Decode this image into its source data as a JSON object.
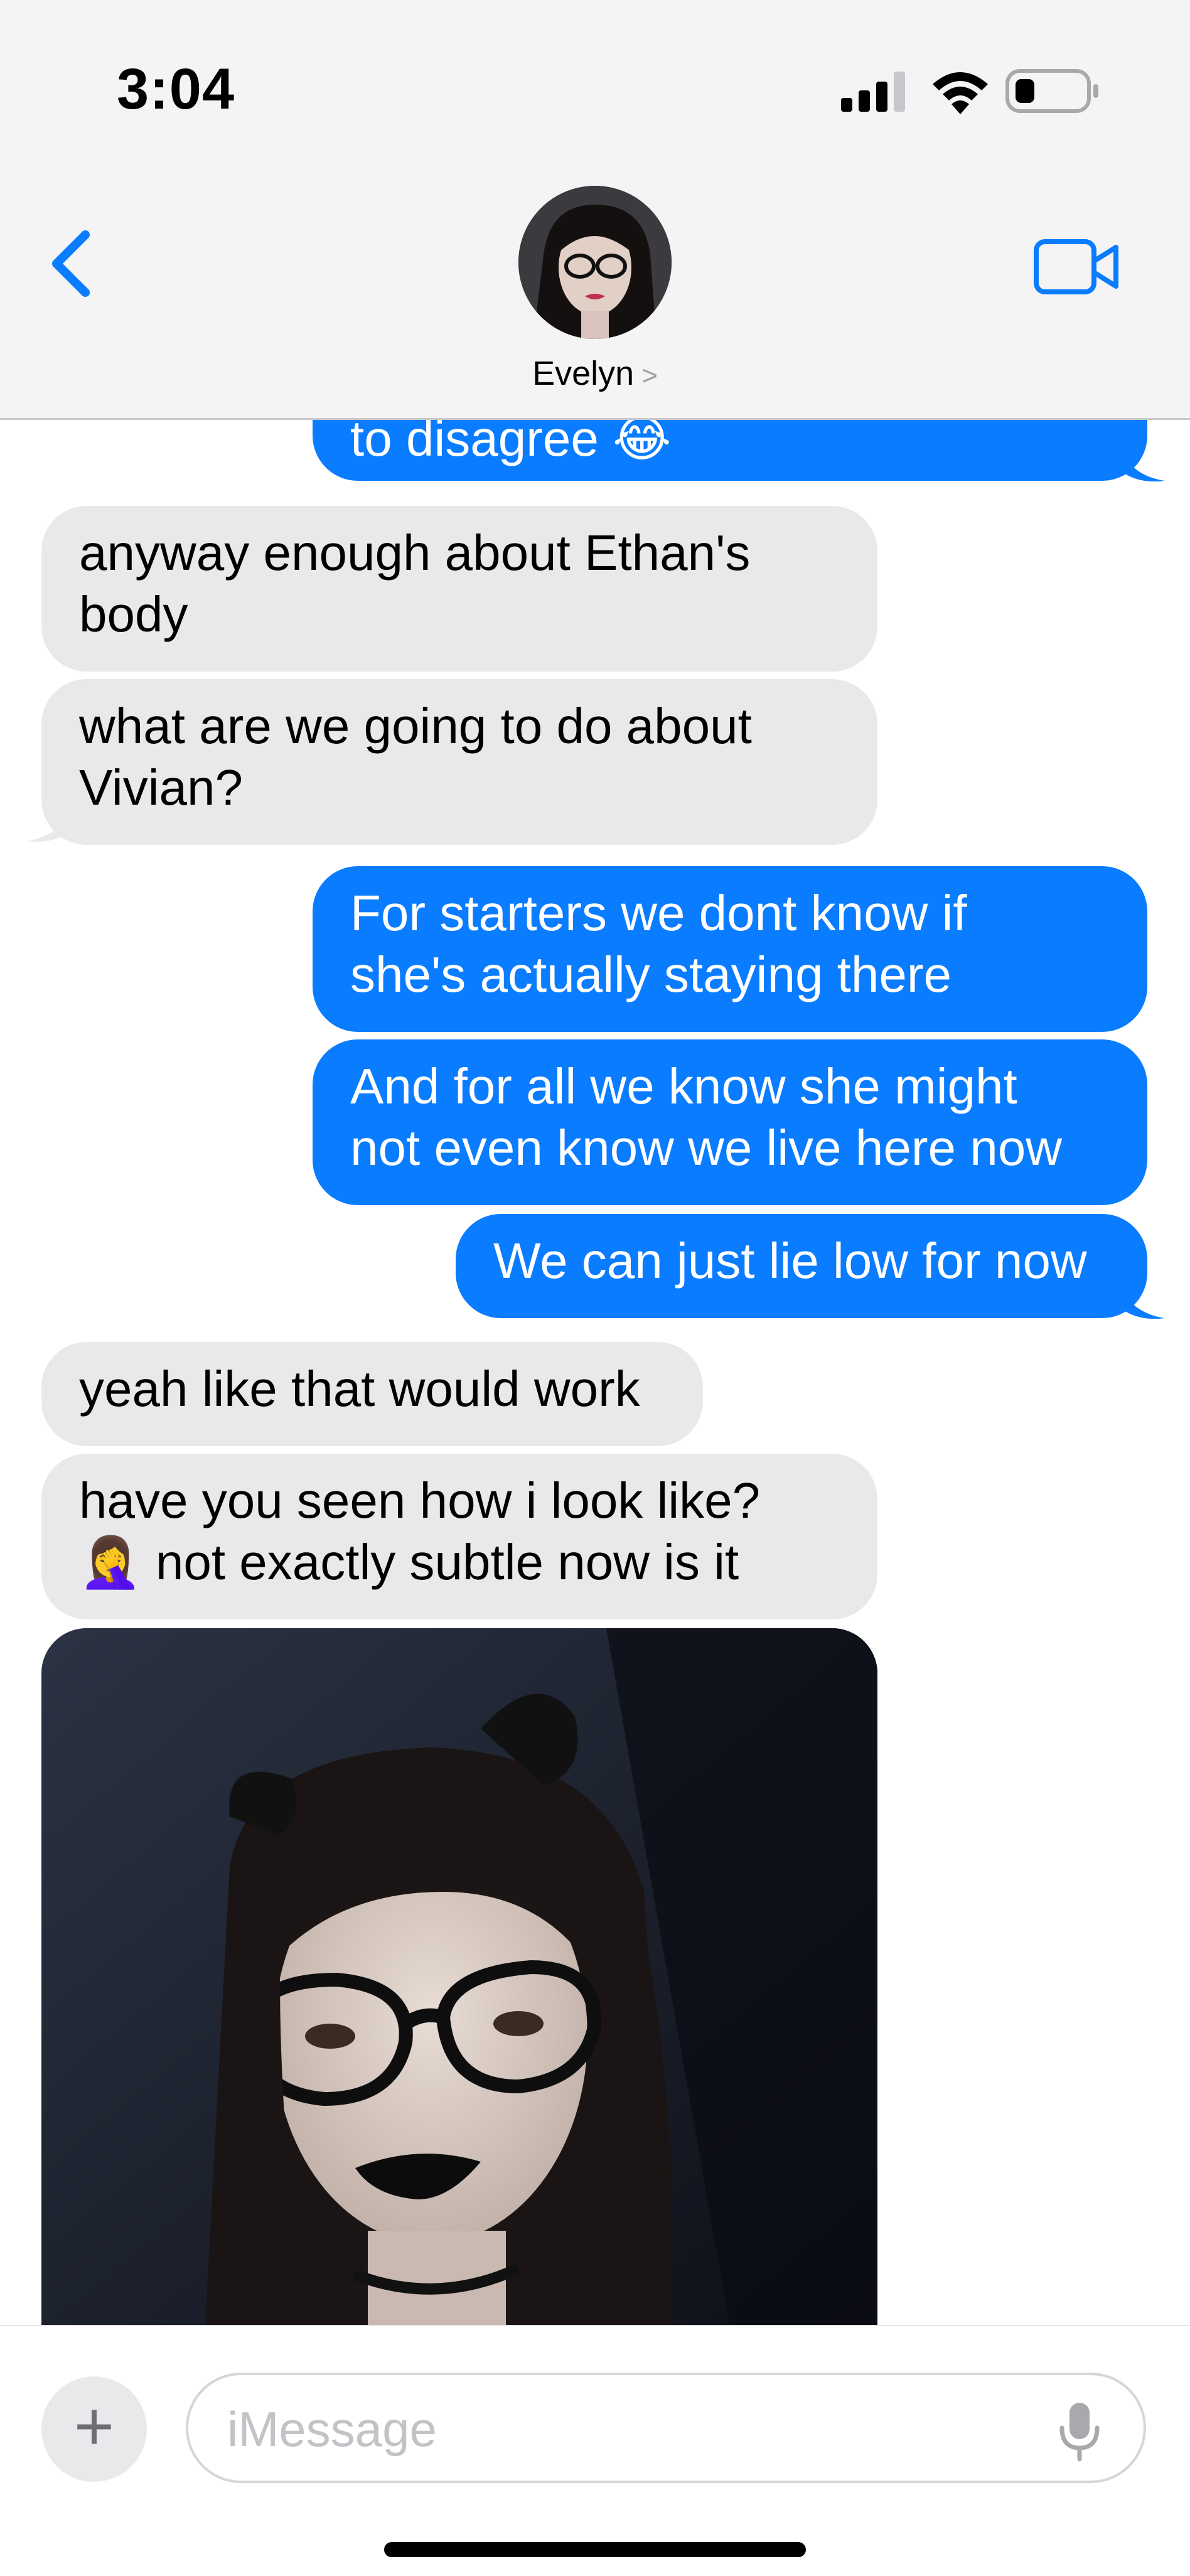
{
  "status_bar": {
    "time": "3:04"
  },
  "header": {
    "contact_name": "Evelyn",
    "chevron": ">"
  },
  "messages": [
    {
      "from": "me",
      "text": "to disagree 😂"
    },
    {
      "from": "them",
      "text": "anyway enough about Ethan's\nbody"
    },
    {
      "from": "them",
      "text": "what are we going to do about\nVivian?"
    },
    {
      "from": "me",
      "text": "For starters we dont know if\nshe's actually staying there"
    },
    {
      "from": "me",
      "text": "And for all we know she might\nnot even know we live here now"
    },
    {
      "from": "me",
      "text": "We can just lie low for now"
    },
    {
      "from": "them",
      "text": "yeah like that would work"
    },
    {
      "from": "them",
      "text": "have you seen how i look like?\n🤦‍♀️ not exactly subtle now is it"
    }
  ],
  "input_bar": {
    "plus_label": "+",
    "placeholder": "iMessage"
  },
  "colors": {
    "outgoing_bubble": "#0a7cff",
    "incoming_bubble": "#e9e9eb",
    "accent": "#0a7cff"
  },
  "icons": [
    "back-chevron-icon",
    "video-camera-icon",
    "signal-icon",
    "wifi-icon",
    "battery-icon",
    "microphone-icon"
  ]
}
